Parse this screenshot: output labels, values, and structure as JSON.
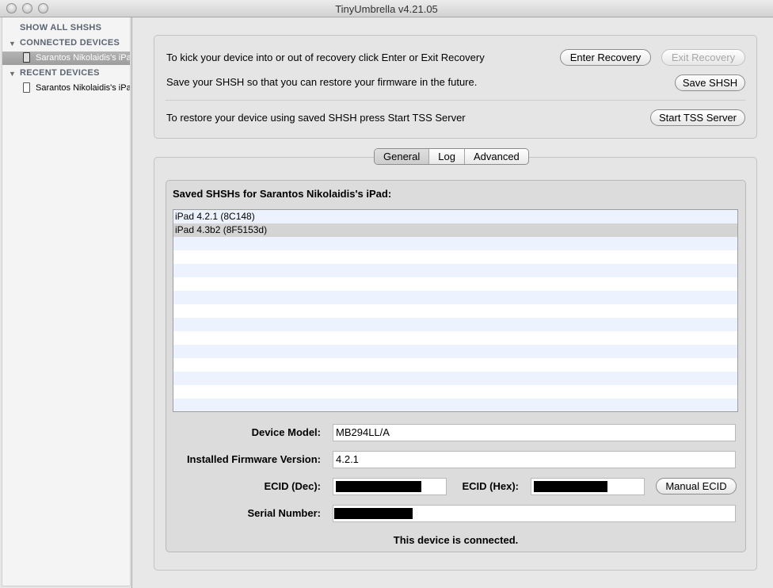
{
  "window": {
    "title": "TinyUmbrella v4.21.05"
  },
  "sidebar": {
    "show_all": "SHOW ALL SHSHS",
    "connected_header": "CONNECTED DEVICES",
    "connected_device": "Sarantos Nikolaidis's iPad",
    "recent_header": "RECENT DEVICES",
    "recent_device": "Sarantos Nikolaidis's iPad"
  },
  "actions": {
    "recovery_text": "To kick your device into or out of recovery click Enter or Exit Recovery",
    "enter_recovery": "Enter Recovery",
    "exit_recovery": "Exit Recovery",
    "save_text": "Save your SHSH so that you can restore your firmware in the future.",
    "save_shsh": "Save SHSH",
    "tss_text": "To restore your device using saved SHSH press Start TSS Server",
    "start_tss": "Start TSS Server"
  },
  "tabs": [
    "General",
    "Log",
    "Advanced"
  ],
  "general": {
    "saved_title": "Saved SHSHs for Sarantos Nikolaidis's iPad:",
    "shsh_list": [
      "iPad 4.2.1 (8C148)",
      "iPad 4.3b2 (8F5153d)",
      "",
      "",
      "",
      "",
      "",
      "",
      "",
      "",
      "",
      "",
      "",
      "",
      ""
    ],
    "device_model_label": "Device Model:",
    "device_model": "MB294LL/A",
    "firmware_label": "Installed Firmware Version:",
    "firmware": "4.2.1",
    "ecid_dec_label": "ECID (Dec):",
    "ecid_hex_label": "ECID (Hex):",
    "manual_ecid": "Manual ECID",
    "serial_label": "Serial Number:",
    "status": "This device is connected."
  }
}
